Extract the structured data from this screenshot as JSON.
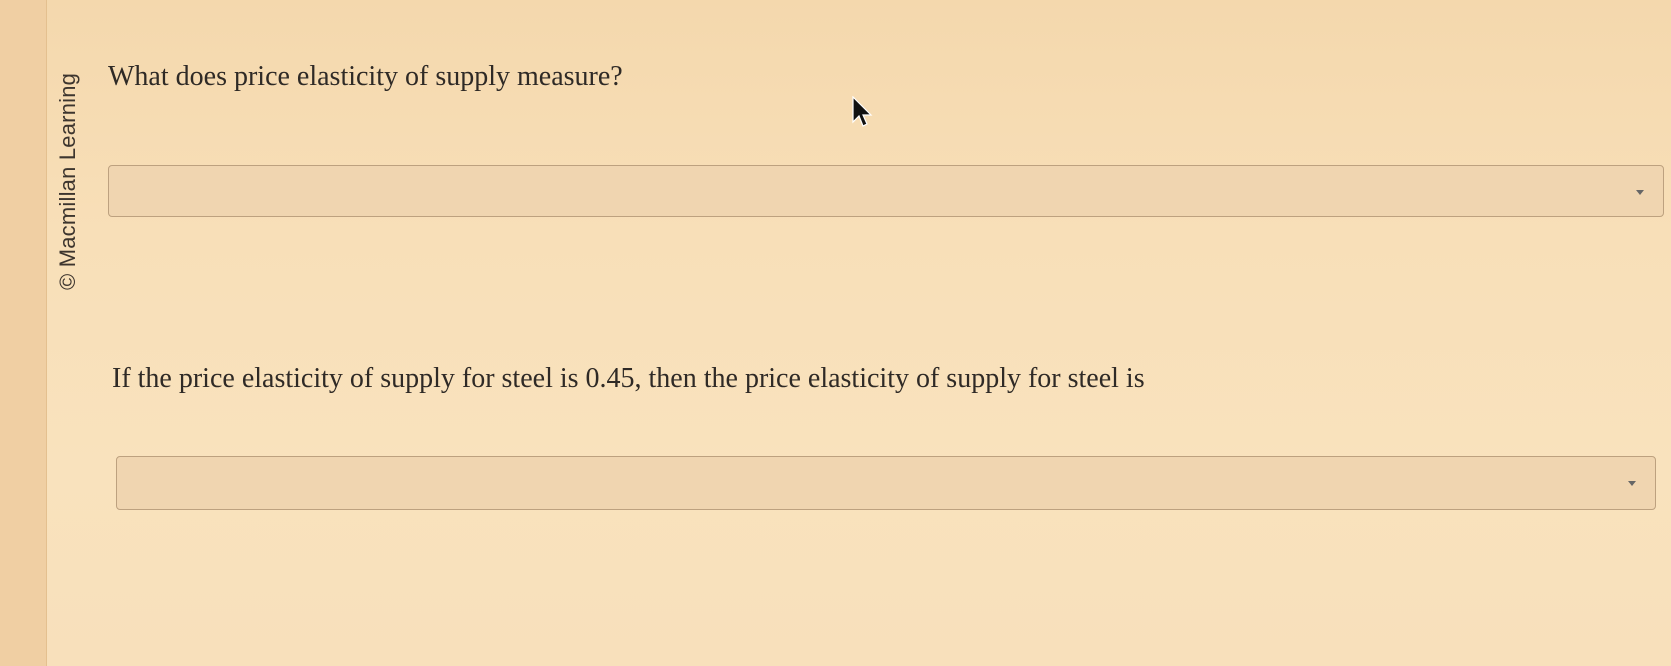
{
  "sidebar": {
    "copyright": "© Macmillan Learning"
  },
  "questions": [
    {
      "text": "What does price elasticity of supply measure?",
      "select": {
        "selected_value": ""
      }
    },
    {
      "text": "If the price elasticity of supply for steel is 0.45, then the price elasticity of supply for steel is",
      "select": {
        "selected_value": ""
      }
    }
  ],
  "icons": {
    "dropdown": "chevron-down-icon",
    "cursor": "mouse-pointer-icon"
  },
  "colors": {
    "background": "#f8dfb8",
    "text": "#2f2a26",
    "select_background": "#f0d5b0",
    "select_border": "#bda17f"
  }
}
